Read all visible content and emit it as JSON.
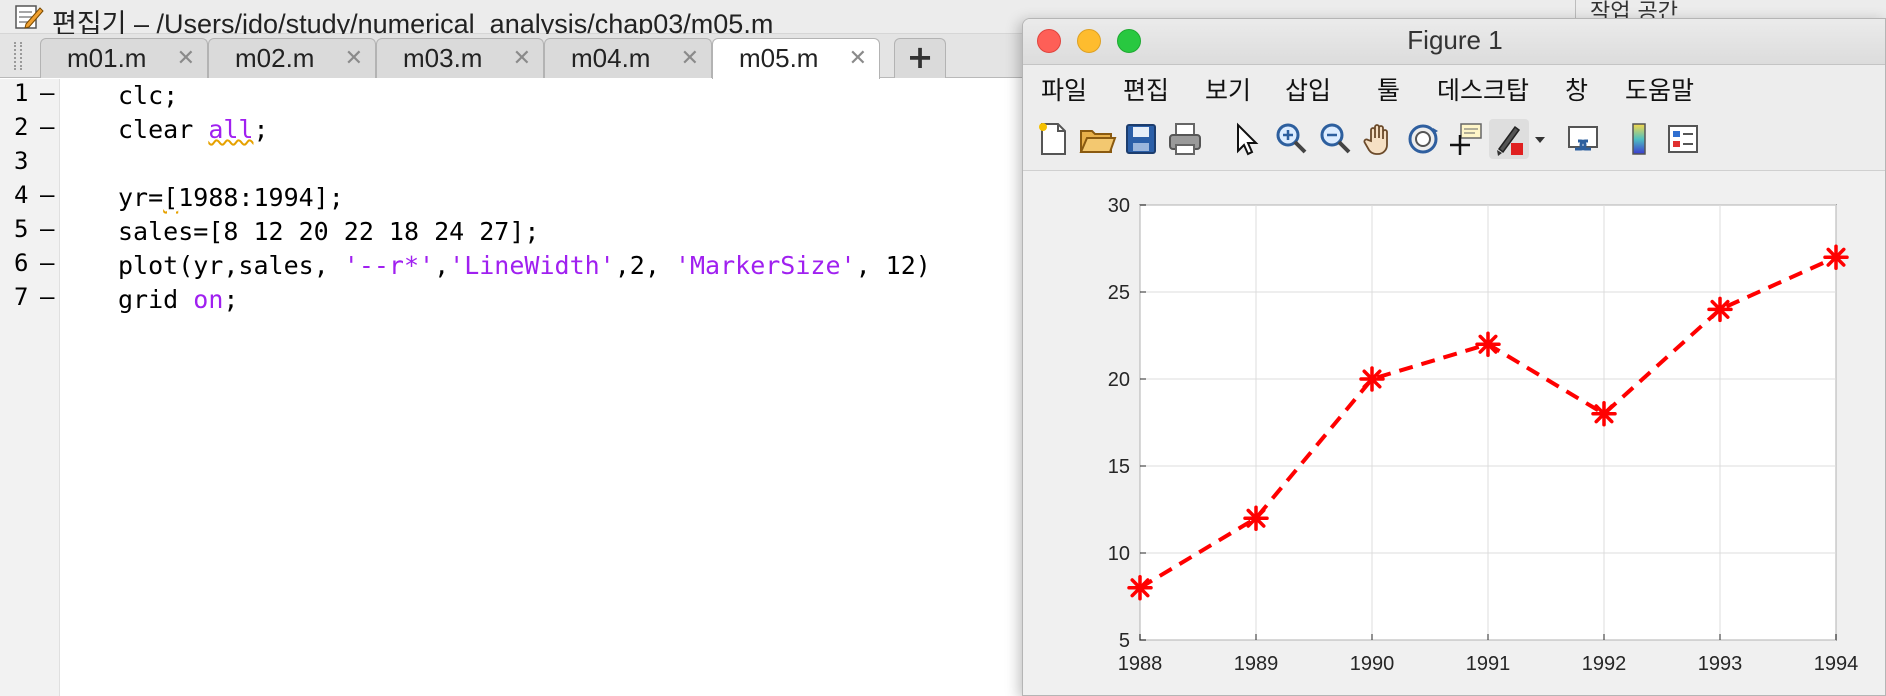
{
  "editor": {
    "title": "편집기 – /Users/jdo/study/numerical_analysis/chap03/m05.m",
    "workspace_label": "작업 공간",
    "tabs": [
      {
        "label": "m01.m",
        "active": false
      },
      {
        "label": "m02.m",
        "active": false
      },
      {
        "label": "m03.m",
        "active": false
      },
      {
        "label": "m04.m",
        "active": false
      },
      {
        "label": "m05.m",
        "active": true
      }
    ],
    "tab_close_glyph": "✕",
    "add_tab_glyph": "+",
    "line_numbers": [
      "1",
      "2",
      "3",
      "4",
      "5",
      "6",
      "7"
    ],
    "line_markers": [
      "–",
      "–",
      "",
      "–",
      "–",
      "–",
      "–"
    ],
    "code": {
      "l1": "clc;",
      "l2_a": "clear ",
      "l2_b": "all",
      "l2_c": ";",
      "l4_a": "yr=",
      "l4_b": "[",
      "l4_c": "1988:1994];",
      "l5": "sales=[8 12 20 22 18 24 27];",
      "l6_a": "plot(yr,sales, ",
      "l6_b": "'--r*'",
      "l6_c": ",",
      "l6_d": "'LineWidth'",
      "l6_e": ",2, ",
      "l6_f": "'MarkerSize'",
      "l6_g": ", 12)",
      "l7_a": "grid ",
      "l7_b": "on",
      "l7_c": ";"
    }
  },
  "figure": {
    "title": "Figure 1",
    "menu": [
      "파일",
      "편집",
      "보기",
      "삽입",
      "툴",
      "데스크탑",
      "창",
      "도움말"
    ],
    "toolbar_icons": [
      "new-figure-icon",
      "open-file-icon",
      "save-icon",
      "print-icon",
      "pointer-icon",
      "zoom-in-icon",
      "zoom-out-icon",
      "pan-hand-icon",
      "rotate-3d-icon",
      "data-cursor-icon",
      "brush-icon",
      "brush-dropdown-icon",
      "link-plot-icon",
      "colorbar-icon",
      "legend-icon"
    ]
  },
  "colors": {
    "series": "#ff0000",
    "keyword": "#a020f0",
    "grid": "#dcdcdc"
  },
  "chart_data": {
    "type": "line",
    "title": "",
    "xlabel": "",
    "ylabel": "",
    "x": [
      1988,
      1989,
      1990,
      1991,
      1992,
      1993,
      1994
    ],
    "series": [
      {
        "values": [
          8,
          12,
          20,
          22,
          18,
          24,
          27
        ],
        "line_style": "dashed",
        "marker": "asterisk",
        "color": "#ff0000"
      }
    ],
    "xlim": [
      1988,
      1994
    ],
    "ylim": [
      5,
      30
    ],
    "xticks": [
      "1988",
      "1989",
      "1990",
      "1991",
      "1992",
      "1993",
      "1994"
    ],
    "yticks": [
      "5",
      "10",
      "15",
      "20",
      "25",
      "30"
    ],
    "grid": true
  }
}
